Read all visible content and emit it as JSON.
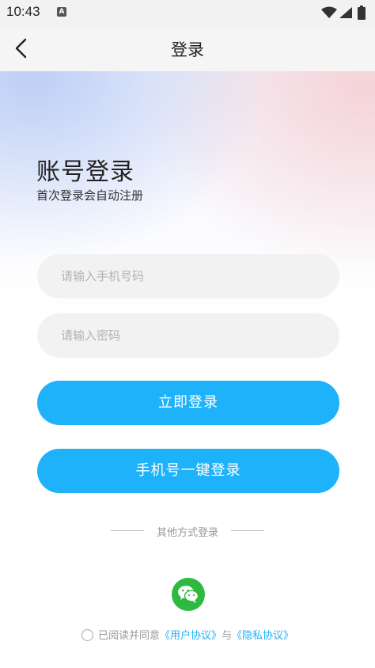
{
  "status_bar": {
    "time": "10:43",
    "notification_badge": "A",
    "icons": [
      "wifi-icon",
      "signal-icon",
      "battery-icon"
    ]
  },
  "nav": {
    "title": "登录",
    "back_icon": "chevron-left-icon"
  },
  "login": {
    "title": "账号登录",
    "subtitle": "首次登录会自动注册",
    "phone_placeholder": "请输入手机号码",
    "password_placeholder": "请输入密码",
    "login_button": "立即登录",
    "oneclick_button": "手机号一键登录",
    "other_methods": "其他方式登录",
    "social_icon": "wechat-icon"
  },
  "agreement": {
    "prefix": "已阅读并同意",
    "user_agreement": "《用户协议》",
    "conjunction": "与",
    "privacy_policy": "《隐私协议》"
  },
  "colors": {
    "primary": "#1eb2fb",
    "wechat": "#2fba3f",
    "input_bg": "#f2f2f2"
  }
}
